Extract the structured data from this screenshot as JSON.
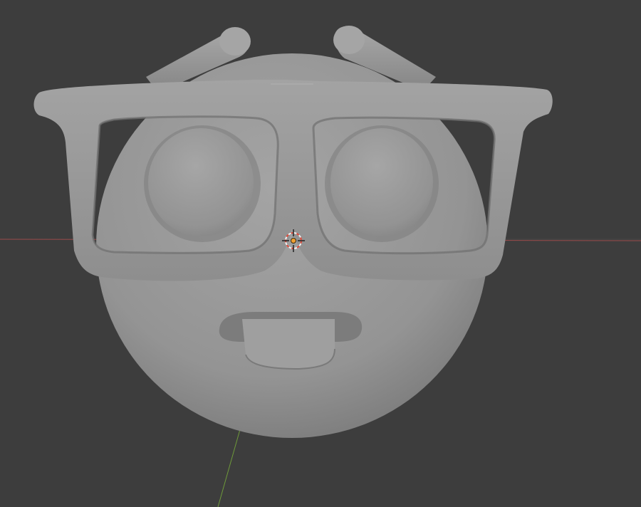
{
  "viewport": {
    "background_color": "#3d3d3d",
    "grid_color": "#474747",
    "x_axis_color": "#9a4a4a",
    "y_axis_color": "#6e9a3a",
    "object_color": "#9a9a9a",
    "view": "front",
    "shading": "solid"
  },
  "scene": {
    "object": "nerd-face-sculpt",
    "parts": [
      {
        "name": "head",
        "icon": "sphere-icon"
      },
      {
        "name": "left-antenna",
        "icon": "capsule-icon"
      },
      {
        "name": "right-antenna",
        "icon": "capsule-icon"
      },
      {
        "name": "left-eye",
        "icon": "sphere-icon"
      },
      {
        "name": "right-eye",
        "icon": "sphere-icon"
      },
      {
        "name": "glasses",
        "icon": "glasses-icon"
      },
      {
        "name": "mouth-tooth",
        "icon": "tooth-icon"
      }
    ]
  },
  "origin_marker": {
    "icon": "3d-cursor-icon",
    "ring_color_a": "#e04a3a",
    "ring_color_b": "#f2f2f2",
    "center_color": "#f0a030"
  }
}
